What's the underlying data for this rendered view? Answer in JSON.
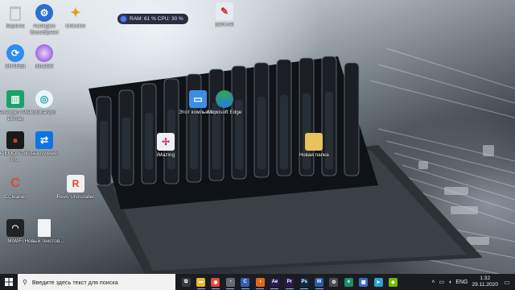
{
  "desktop": {
    "icons": [
      {
        "label": "Корзина",
        "icon": "recycle-bin-icon",
        "color": "#cfd8e0"
      },
      {
        "label": "Auslogics BoostSpeed",
        "icon": "boostspeed-icon",
        "color": "#2a6fd1"
      },
      {
        "label": "Unlocker",
        "icon": "unlocker-icon",
        "color": "#e0a020"
      },
      {
        "label": "paint.net",
        "icon": "paintnet-icon",
        "color": "#e8e8f0"
      },
      {
        "label": "SHAREit",
        "icon": "shareit-icon",
        "color": "#2d8cf0"
      },
      {
        "label": "UltraISO",
        "icon": "ultraiso-icon",
        "color": "#7a3ccf"
      },
      {
        "label": "Auslogics Disk Defrag",
        "icon": "disk-defrag-icon",
        "color": "#19a36b"
      },
      {
        "label": "GlobalVpn",
        "icon": "globalvpn-icon",
        "color": "#1fa0a8"
      },
      {
        "label": "Этот компьютер",
        "icon": "this-pc-icon",
        "color": "#3a8ee6"
      },
      {
        "label": "Microsoft Edge",
        "icon": "edge-icon",
        "color": "#2fa35a"
      },
      {
        "label": "DAEMON Tools Pr...",
        "icon": "daemon-tools-icon",
        "color": "#d63b2f"
      },
      {
        "label": "TeamViewer",
        "icon": "teamviewer-icon",
        "color": "#0e74e6"
      },
      {
        "label": "iMazing",
        "icon": "imazing-icon",
        "color": "#e6e6f0"
      },
      {
        "label": "Новая папка",
        "icon": "folder-icon",
        "color": "#e8c25a"
      },
      {
        "label": "CCleaner",
        "icon": "ccleaner-icon",
        "color": "#e04a2a"
      },
      {
        "label": "Revo Uninstaller",
        "icon": "revo-uninstaller-icon",
        "color": "#d8402a"
      },
      {
        "label": "MiWiFi",
        "icon": "miwifi-icon",
        "color": "#222222"
      },
      {
        "label": "Новый текстов...",
        "icon": "text-document-icon",
        "color": "#f4f4f4"
      }
    ]
  },
  "gadget": {
    "text": "RAM: 61 %  CPU: 30 %"
  },
  "taskbar": {
    "search_placeholder": "Введите здесь текст для поиска",
    "apps": [
      {
        "name": "task-view",
        "glyph": "⧉",
        "color": "#3a3c44"
      },
      {
        "name": "file-explorer",
        "glyph": "▬",
        "color": "#e8b830"
      },
      {
        "name": "chrome",
        "glyph": "◉",
        "color": "#dc4a38"
      },
      {
        "name": "vpn",
        "glyph": "◔",
        "color": "#666a74"
      },
      {
        "name": "cortana",
        "glyph": "C",
        "color": "#2d5fb8"
      },
      {
        "name": "firefox",
        "glyph": "◑",
        "color": "#e06a1c"
      },
      {
        "name": "after-effects",
        "glyph": "Ae",
        "color": "#2a1a55"
      },
      {
        "name": "premiere",
        "glyph": "Pr",
        "color": "#2a1a55"
      },
      {
        "name": "photoshop",
        "glyph": "Ps",
        "color": "#0b2a4a"
      },
      {
        "name": "word",
        "glyph": "W",
        "color": "#2b5aa8"
      },
      {
        "name": "settings",
        "glyph": "⚙",
        "color": "#4a4c54"
      },
      {
        "name": "edge",
        "glyph": "e",
        "color": "#1f8a6a"
      },
      {
        "name": "store",
        "glyph": "▦",
        "color": "#3a6ec8"
      },
      {
        "name": "telegram",
        "glyph": "➤",
        "color": "#2aa0d8"
      },
      {
        "name": "nvidia",
        "glyph": "◆",
        "color": "#76b900"
      }
    ],
    "tray": {
      "lang": "ENG",
      "time": "1:32",
      "date": "29.11.2020"
    }
  }
}
